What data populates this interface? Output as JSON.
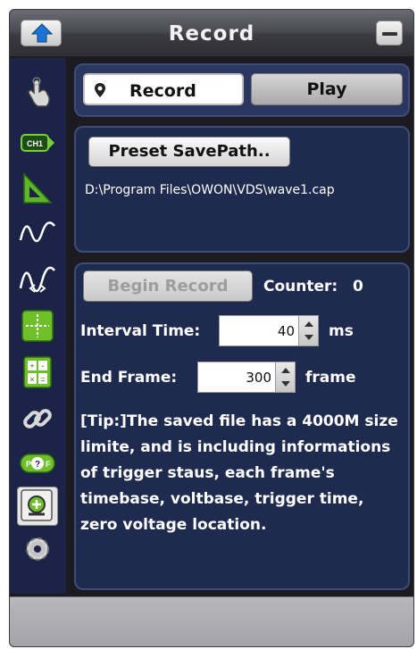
{
  "window": {
    "title": "Record"
  },
  "tabs": {
    "record_label": "Record",
    "play_label": "Play",
    "active": "Record"
  },
  "save_path": {
    "button_label": "Preset SavePath..",
    "path": "D:\\Program Files\\OWON\\VDS\\wave1.cap"
  },
  "recording": {
    "begin_label": "Begin Record",
    "counter_label": "Counter:",
    "counter_value": "0",
    "interval_label": "Interval Time:",
    "interval_value": "40",
    "interval_unit": "ms",
    "end_frame_label": "End Frame:",
    "end_frame_value": "300",
    "end_frame_unit": "frame",
    "tip": "[Tip:]The saved file has a 4000M size limite, and is including informations of trigger staus, each frame's timebase, voltbase, trigger time, zero voltage location."
  },
  "sidebar": {
    "items": [
      {
        "icon": "touch-hand-icon"
      },
      {
        "icon": "ch1-icon",
        "label": "CH1"
      },
      {
        "icon": "triangle-ruler-icon"
      },
      {
        "icon": "waveform-icon"
      },
      {
        "icon": "dual-waveform-icon"
      },
      {
        "icon": "crosshair-icon"
      },
      {
        "icon": "calculator-icon"
      },
      {
        "icon": "chain-link-icon"
      },
      {
        "icon": "pass-fail-icon",
        "label": "P?F"
      },
      {
        "icon": "record-zoom-icon",
        "active": true
      },
      {
        "icon": "gear-icon"
      }
    ]
  },
  "colors": {
    "sidebar_bg": "#1b2347",
    "panel_bg": "#1f2a4f",
    "panel_border": "#3e4c78",
    "accent_green": "#6fbf2a",
    "arrow_blue": "#1e73d6"
  }
}
